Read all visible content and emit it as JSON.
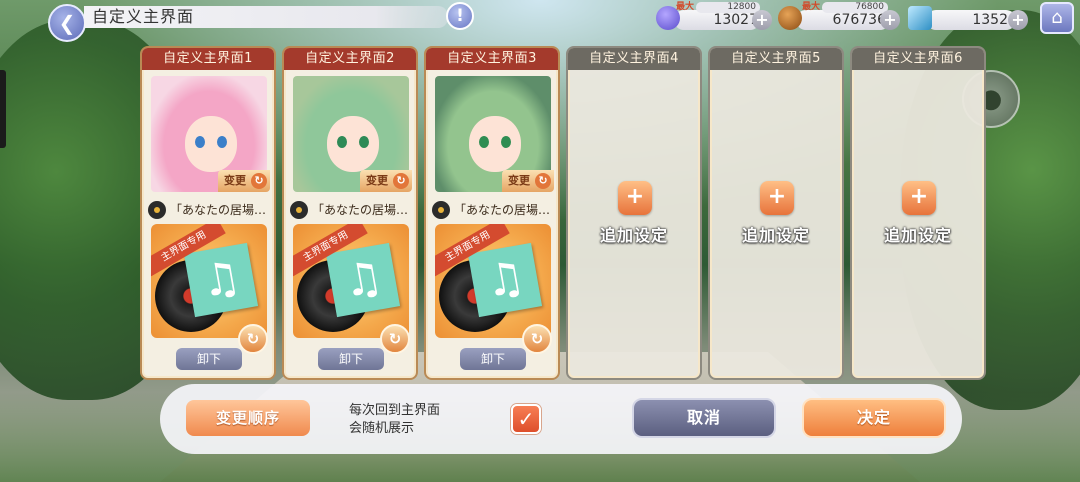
{
  "header": {
    "title": "自定义主界面",
    "back_icon": "arrow-left-icon",
    "info_glyph": "!",
    "home_icon": "home-icon"
  },
  "currencies": [
    {
      "name": "spirit-orb",
      "cap_label": "最大",
      "cap": "12800",
      "value": "13027",
      "color": "#6b5fd6"
    },
    {
      "name": "gold",
      "cap_label": "最大",
      "cap": "76800",
      "value": "676736",
      "color": "#b0671f"
    },
    {
      "name": "crystal",
      "cap_label": "",
      "cap": "",
      "value": "1352",
      "color": "#3fa9d6"
    }
  ],
  "slots": [
    {
      "title": "自定义主界面1",
      "filled": true,
      "change_label": "变更",
      "music": "「あなたの居場…",
      "music_tag": "主界面专用",
      "unload_label": "卸下",
      "hair": "#f4a6c6",
      "eye": "#3b7fc9",
      "portrait_bg": "#f7d7e4"
    },
    {
      "title": "自定义主界面2",
      "filled": true,
      "change_label": "变更",
      "music": "「あなたの居場…",
      "music_tag": "主界面专用",
      "unload_label": "卸下",
      "hair": "#8fc79a",
      "eye": "#2e8a56",
      "portrait_bg": "#a7c79a"
    },
    {
      "title": "自定义主界面3",
      "filled": true,
      "change_label": "变更",
      "music": "「あなたの居場…",
      "music_tag": "主界面专用",
      "unload_label": "卸下",
      "hair": "#93c48e",
      "eye": "#2f8d52",
      "portrait_bg": "#5e8e6a"
    },
    {
      "title": "自定义主界面4",
      "filled": false,
      "add_label": "追加设定"
    },
    {
      "title": "自定义主界面5",
      "filled": false,
      "add_label": "追加设定"
    },
    {
      "title": "自定义主界面6",
      "filled": false,
      "add_label": "追加设定"
    }
  ],
  "bottom": {
    "order_label": "变更顺序",
    "random_text_line1": "每次回到主界面",
    "random_text_line2": "会随机展示",
    "random_checked": true,
    "cancel_label": "取消",
    "confirm_label": "决定"
  },
  "colors": {
    "accent_orange": "#ee7f3c",
    "slot_header": "#a43a2c",
    "cancel": "#5b5f80"
  }
}
